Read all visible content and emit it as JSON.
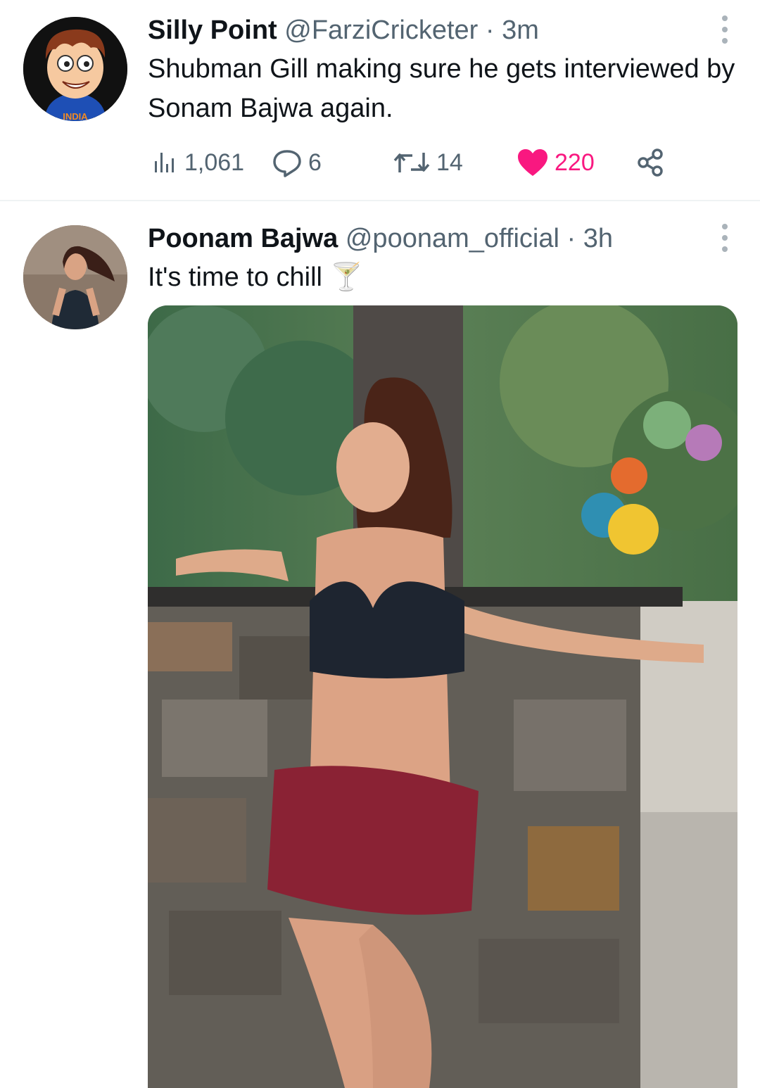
{
  "tweets": [
    {
      "name": "Silly Point",
      "handle": "@FarziCricketer",
      "separator": "·",
      "time": "3m",
      "text": "Shubman Gill making sure he gets interviewed by Sonam Bajwa again.",
      "avatar_text": "INDIA",
      "stats": {
        "views": "1,061",
        "replies": "6",
        "retweets": "14",
        "likes": "220"
      },
      "liked": true,
      "colors": {
        "like": "#f91880",
        "muted": "#536471"
      }
    },
    {
      "name": "Poonam Bajwa",
      "handle": "@poonam_official",
      "separator": "·",
      "time": "3h",
      "text": "It's time to chill 🍸",
      "media": "photo"
    }
  ]
}
